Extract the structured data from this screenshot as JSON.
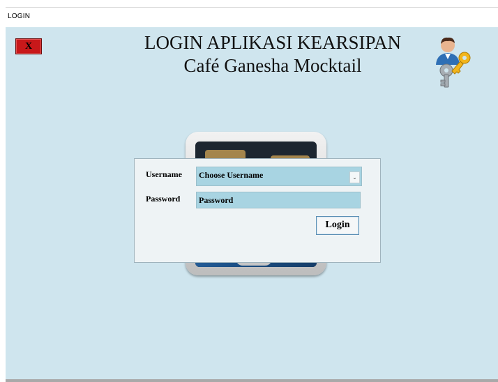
{
  "window": {
    "title": "LOGIN"
  },
  "header": {
    "close_label": "X",
    "title_main": "LOGIN APLIKASI KEARSIPAN",
    "title_sub": "Café Ganesha Mocktail"
  },
  "form": {
    "username_label": "Username",
    "username_value": "Choose Username",
    "password_label": "Password",
    "password_value": "Password",
    "login_label": "Login"
  },
  "icons": {
    "header": "user-key-icon",
    "dropdown": "chevron-down-icon"
  },
  "colors": {
    "background": "#cfe5ee",
    "field": "#a8d4e2",
    "close_button": "#c8181a"
  }
}
